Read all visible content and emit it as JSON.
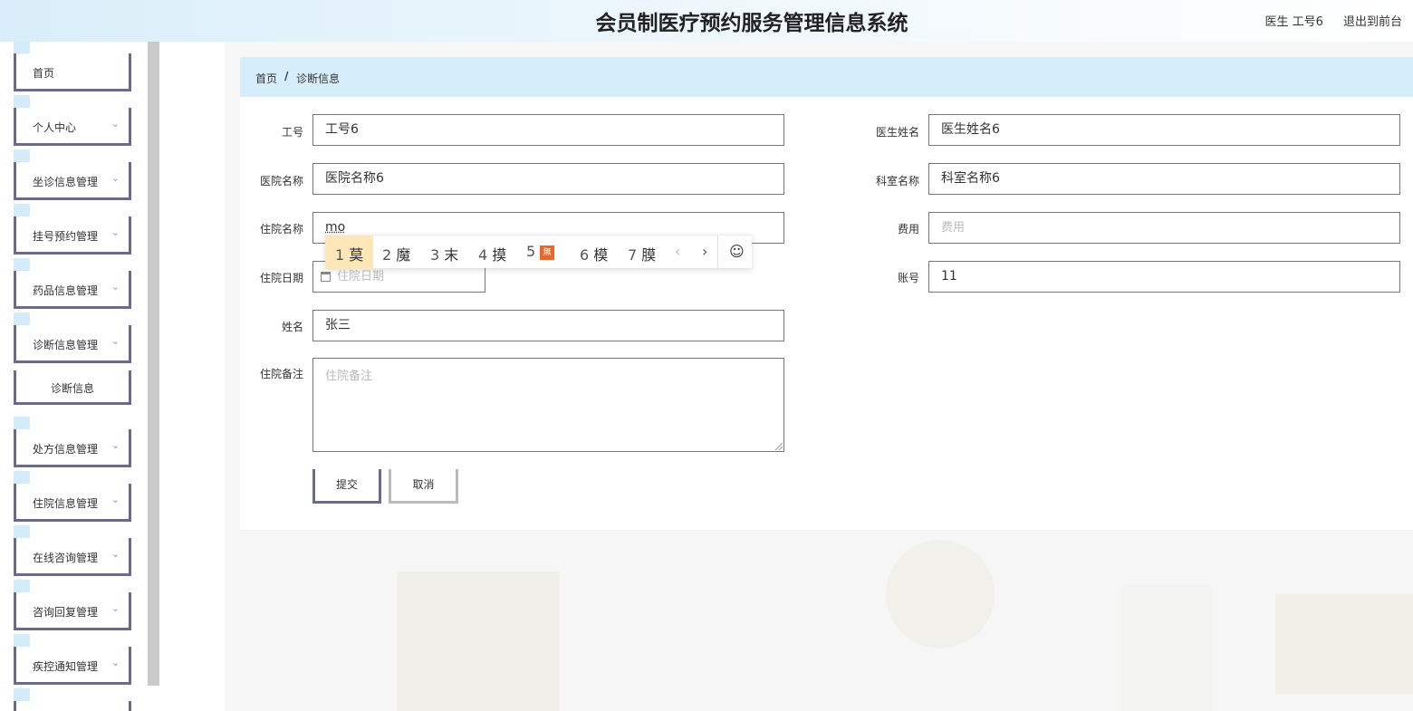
{
  "header": {
    "title": "会员制医疗预约服务管理信息系统",
    "user": "医生 工号6",
    "exit": "退出到前台"
  },
  "sidebar": {
    "items": [
      {
        "label": "首页",
        "has_chevron": false
      },
      {
        "label": "个人中心",
        "has_chevron": true
      },
      {
        "label": "坐诊信息管理",
        "has_chevron": true
      },
      {
        "label": "挂号预约管理",
        "has_chevron": true
      },
      {
        "label": "药品信息管理",
        "has_chevron": true
      },
      {
        "label": "诊断信息管理",
        "has_chevron": true
      },
      {
        "label": "诊断信息",
        "has_chevron": false,
        "sub": true
      },
      {
        "label": "处方信息管理",
        "has_chevron": true
      },
      {
        "label": "住院信息管理",
        "has_chevron": true
      },
      {
        "label": "在线咨询管理",
        "has_chevron": true
      },
      {
        "label": "咨询回复管理",
        "has_chevron": true
      },
      {
        "label": "疾控通知管理",
        "has_chevron": true
      }
    ],
    "chevron": "chevron-down-icon"
  },
  "breadcrumb": {
    "home": "首页",
    "separator": "/",
    "current": "诊断信息"
  },
  "form": {
    "job_no": {
      "label": "工号",
      "value": "工号6"
    },
    "doctor_name": {
      "label": "医生姓名",
      "value": "医生姓名6"
    },
    "hospital_name": {
      "label": "医院名称",
      "value": "医院名称6"
    },
    "dept_name": {
      "label": "科室名称",
      "value": "科室名称6"
    },
    "ward_name": {
      "label": "住院名称",
      "value": "mo"
    },
    "fee": {
      "label": "费用",
      "placeholder": "费用"
    },
    "admit_date": {
      "label": "住院日期",
      "placeholder": "住院日期"
    },
    "account": {
      "label": "账号",
      "value": "11"
    },
    "name": {
      "label": "姓名",
      "value": "张三"
    },
    "remarks": {
      "label": "住院备注",
      "placeholder": "住院备注"
    },
    "submit": "提交",
    "cancel": "取消"
  },
  "ime": {
    "candidates": [
      {
        "n": "1",
        "text": "莫"
      },
      {
        "n": "2",
        "text": "魔"
      },
      {
        "n": "3",
        "text": "末"
      },
      {
        "n": "4",
        "text": "摸"
      },
      {
        "n": "5",
        "text": "無"
      },
      {
        "n": "6",
        "text": "模"
      },
      {
        "n": "7",
        "text": "膜"
      }
    ],
    "prev": "‹",
    "next": "›",
    "emoji": "☺",
    "selected_color": "#fde7b8"
  },
  "colors": {
    "accent_border": "#6a6a8e",
    "breadcrumb_bg": "#d6eefb",
    "header_bg": "#d9eefa"
  }
}
